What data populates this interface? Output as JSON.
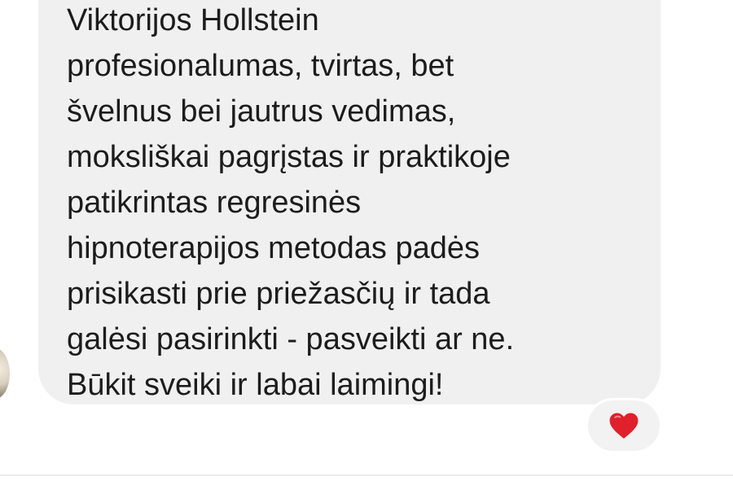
{
  "message": {
    "lines": [
      "Viktorijos Hollstein",
      "profesionalumas, tvirtas, bet",
      "švelnus bei jautrus vedimas,",
      "moksliškai pagrįstas ir praktikoje",
      "patikrintas regresinės",
      "hipnoterapijos metodas padės",
      "prisikasti prie priežasčių ir tada",
      "galėsi pasirinkti - pasveikti ar ne.",
      "Būkit sveiki ir labai laimingi!"
    ],
    "bubble_color": "#f0f0f0",
    "text_color": "#1c1c1c"
  },
  "reaction": {
    "icon": "heart-icon",
    "color": "#e0202a"
  }
}
